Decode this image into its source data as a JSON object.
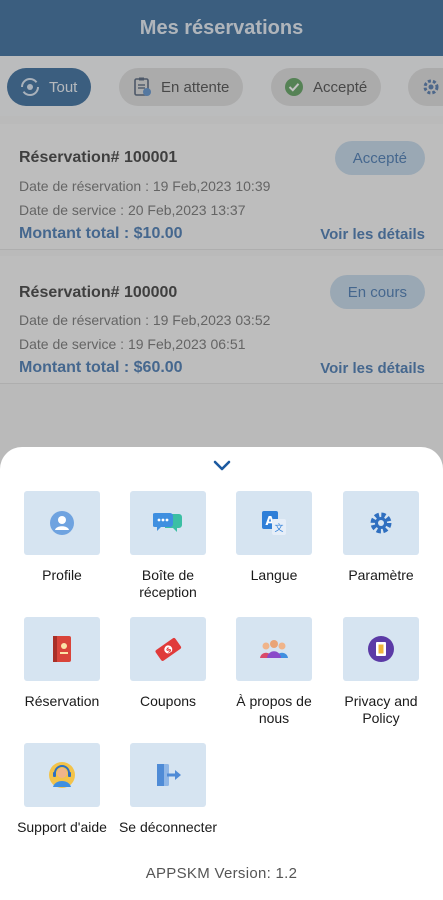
{
  "header": {
    "title": "Mes réservations"
  },
  "tabs": [
    {
      "label": "Tout",
      "icon": "refresh-icon",
      "active": true
    },
    {
      "label": "En attente",
      "icon": "clipboard-icon",
      "active": false
    },
    {
      "label": "Accepté",
      "icon": "check-circle-icon",
      "active": false
    },
    {
      "label": "",
      "icon": "gear-icon",
      "active": false
    }
  ],
  "reservations": [
    {
      "title": "Réservation# 100001",
      "status": "Accepté",
      "reservation_date": "Date de réservation : 19 Feb,2023 10:39",
      "service_date": "Date de service : 20 Feb,2023 13:37",
      "total": "Montant total : $10.00",
      "details_link": "Voir les détails"
    },
    {
      "title": "Réservation# 100000",
      "status": "En cours",
      "reservation_date": "Date de réservation : 19 Feb,2023 03:52",
      "service_date": "Date de service : 19 Feb,2023 06:51",
      "total": "Montant total : $60.00",
      "details_link": "Voir les détails"
    }
  ],
  "menu": {
    "items": [
      {
        "label": "Profile",
        "icon": "user-icon"
      },
      {
        "label": "Boîte de réception",
        "icon": "chat-bubble-icon"
      },
      {
        "label": "Langue",
        "icon": "translate-icon"
      },
      {
        "label": "Paramètre",
        "icon": "gear-icon"
      },
      {
        "label": "Réservation",
        "icon": "booking-book-icon"
      },
      {
        "label": "Coupons",
        "icon": "coupon-icon"
      },
      {
        "label": "À propos de nous",
        "icon": "team-icon"
      },
      {
        "label": "Privacy and Policy",
        "icon": "privacy-document-icon"
      },
      {
        "label": "Support d'aide",
        "icon": "support-agent-icon"
      },
      {
        "label": "Se déconnecter",
        "icon": "logout-icon"
      }
    ],
    "version": "APPSKM Version: 1.2"
  },
  "colors": {
    "primary": "#0a4a86",
    "accent_text": "#1c5aa0",
    "badge_bg": "#b7cfe6",
    "tile_bg": "#d6e4f1"
  }
}
